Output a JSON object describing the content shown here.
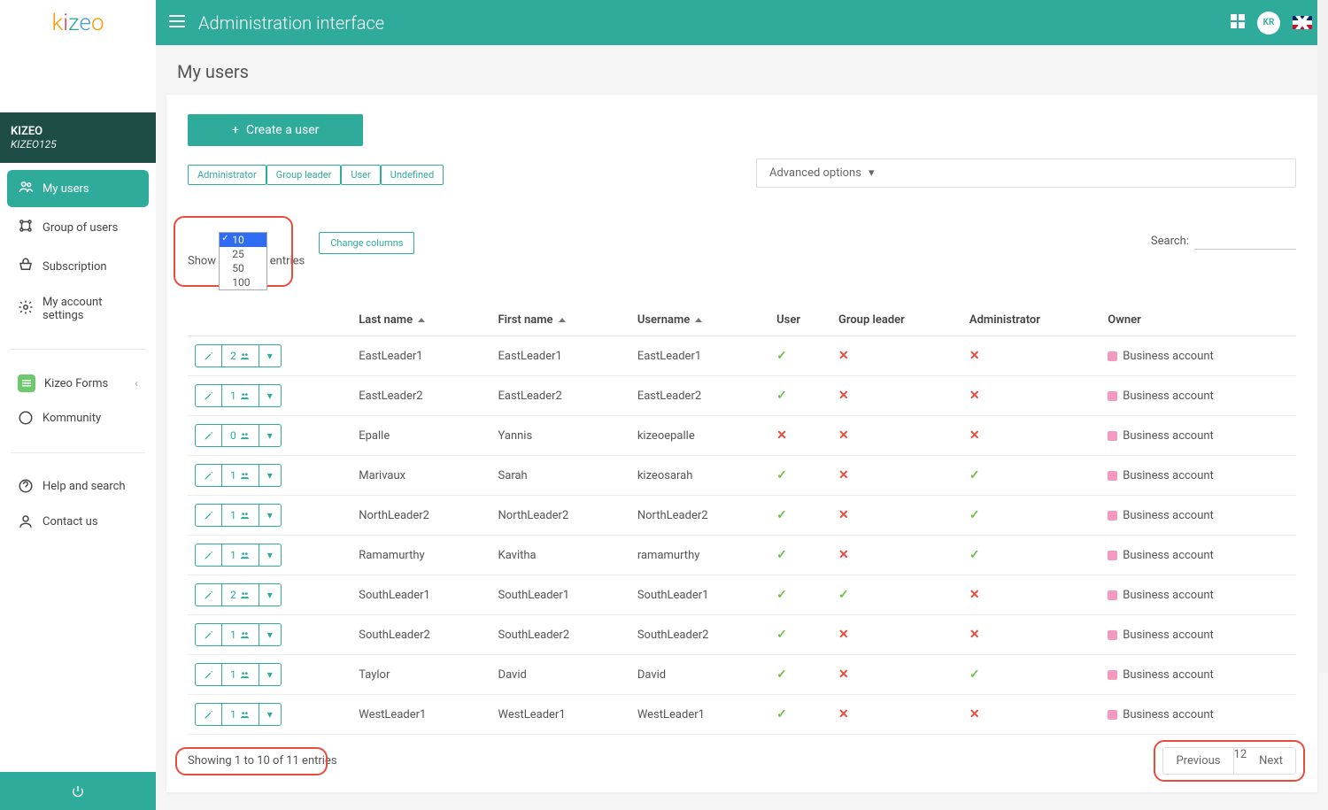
{
  "header": {
    "title": "Administration interface",
    "avatar": "KR"
  },
  "org": {
    "name": "KIZEO",
    "code": "KIZEO125"
  },
  "sidebar": {
    "items": [
      {
        "label": "My users",
        "icon": "users",
        "active": true
      },
      {
        "label": "Group of users",
        "icon": "group"
      },
      {
        "label": "Subscription",
        "icon": "basket"
      },
      {
        "label": "My account settings",
        "icon": "gear"
      }
    ],
    "extra": [
      {
        "label": "Kizeo Forms"
      },
      {
        "label": "Kommunity"
      }
    ],
    "bottom": [
      {
        "label": "Help and search"
      },
      {
        "label": "Contact us"
      }
    ]
  },
  "page": {
    "title": "My users",
    "create_label": "Create a user",
    "filters": [
      "Administrator",
      "Group leader",
      "User",
      "Undefined"
    ],
    "advanced": "Advanced options",
    "show_label_pre": "Show",
    "show_label_post": "entries",
    "length_options": [
      "10",
      "25",
      "50",
      "100"
    ],
    "length_selected": "10",
    "change_columns": "Change columns",
    "search_label": "Search:"
  },
  "table": {
    "headers": [
      "",
      "Last name",
      "First name",
      "Username",
      "User",
      "Group leader",
      "Administrator",
      "Owner"
    ],
    "rows": [
      {
        "count": "2",
        "last": "EastLeader1",
        "first": "EastLeader1",
        "user": "EastLeader1",
        "u": true,
        "gl": false,
        "ad": false,
        "owner": "Business account"
      },
      {
        "count": "1",
        "last": "EastLeader2",
        "first": "EastLeader2",
        "user": "EastLeader2",
        "u": true,
        "gl": false,
        "ad": false,
        "owner": "Business account"
      },
      {
        "count": "0",
        "last": "Epalle",
        "first": "Yannis",
        "user": "kizeoepalle",
        "u": false,
        "gl": false,
        "ad": false,
        "owner": "Business account"
      },
      {
        "count": "1",
        "last": "Marivaux",
        "first": "Sarah",
        "user": "kizeosarah",
        "u": true,
        "gl": false,
        "ad": true,
        "owner": "Business account"
      },
      {
        "count": "1",
        "last": "NorthLeader2",
        "first": "NorthLeader2",
        "user": "NorthLeader2",
        "u": true,
        "gl": false,
        "ad": true,
        "owner": "Business account"
      },
      {
        "count": "1",
        "last": "Ramamurthy",
        "first": "Kavitha",
        "user": "ramamurthy",
        "u": true,
        "gl": false,
        "ad": true,
        "owner": "Business account"
      },
      {
        "count": "2",
        "last": "SouthLeader1",
        "first": "SouthLeader1",
        "user": "SouthLeader1",
        "u": true,
        "gl": true,
        "ad": false,
        "owner": "Business account"
      },
      {
        "count": "1",
        "last": "SouthLeader2",
        "first": "SouthLeader2",
        "user": "SouthLeader2",
        "u": true,
        "gl": false,
        "ad": false,
        "owner": "Business account"
      },
      {
        "count": "1",
        "last": "Taylor",
        "first": "David",
        "user": "David",
        "u": true,
        "gl": false,
        "ad": true,
        "owner": "Business account"
      },
      {
        "count": "1",
        "last": "WestLeader1",
        "first": "WestLeader1",
        "user": "WestLeader1",
        "u": true,
        "gl": false,
        "ad": false,
        "owner": "Business account"
      }
    ]
  },
  "footer": {
    "info": "Showing 1 to 10 of 11 entries",
    "prev": "Previous",
    "pages": [
      "1",
      "2"
    ],
    "active_page": "1",
    "next": "Next"
  }
}
